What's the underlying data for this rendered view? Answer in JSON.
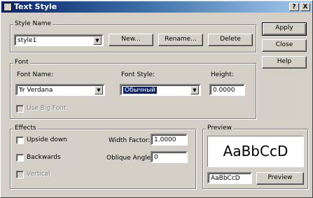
{
  "window": {
    "title": "Text Style",
    "help_btn": "?",
    "close_btn": "X"
  },
  "style_name": {
    "legend": "Style Name",
    "value": "style1",
    "new_label": "New...",
    "rename_label": "Rename...",
    "delete_label": "Delete"
  },
  "actions": {
    "apply": "Apply",
    "close": "Close",
    "help": "Help"
  },
  "font": {
    "legend": "Font",
    "font_name_label": "Font Name:",
    "font_name_value": "Verdana",
    "font_icon": "Tr",
    "font_style_label": "Font Style:",
    "font_style_value": "Обычный",
    "height_label": "Height:",
    "height_value": "0.0000",
    "big_font_label": "Use Big Font"
  },
  "effects": {
    "legend": "Effects",
    "upside_down": "Upside down",
    "backwards": "Backwards",
    "vertical": "Vertical",
    "width_factor_label": "Width Factor:",
    "width_factor_value": "1.0000",
    "oblique_label": "Oblique Angle:",
    "oblique_value": "0"
  },
  "preview": {
    "legend": "Preview",
    "sample": "AaBbCcD",
    "input_value": "AaBbCcD",
    "button": "Preview"
  }
}
